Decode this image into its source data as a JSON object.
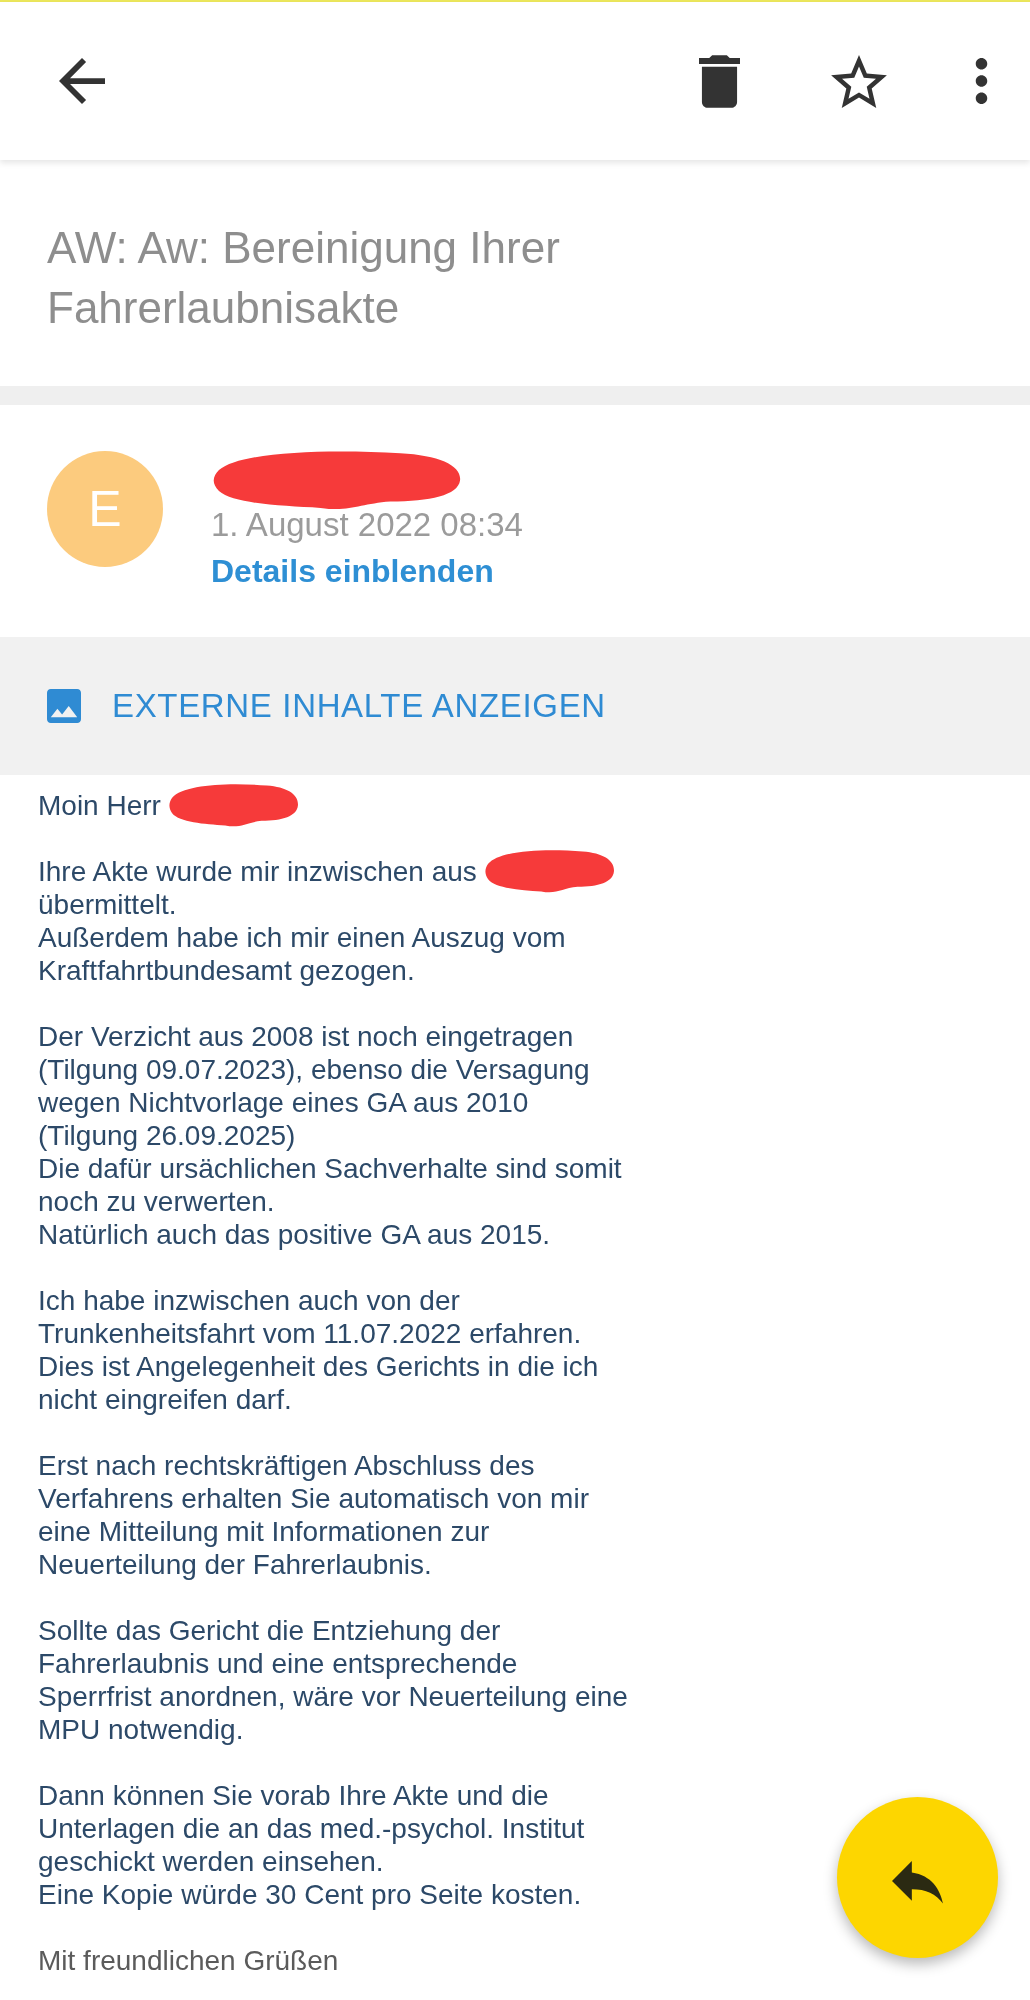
{
  "toolbar": {
    "starred": false
  },
  "subject": "AW: Aw: Bereinigung Ihrer Fahrerlaubnisakte",
  "sender": {
    "initial": "E",
    "name_redacted": true,
    "date": "1. August 2022 08:34",
    "details_link": "Details einblenden"
  },
  "external_content": {
    "label": "EXTERNE INHALTE ANZEIGEN"
  },
  "body": [
    {
      "kind": "text",
      "first_line_redacted": true,
      "lines": [
        "Moin Herr"
      ]
    },
    {
      "kind": "text",
      "first_line_redacted": true,
      "lines": [
        "Ihre Akte wurde mir inzwischen aus",
        "übermittelt.",
        "Außerdem habe ich mir einen Auszug vom",
        "Kraftfahrtbundesamt gezogen."
      ]
    },
    {
      "kind": "text",
      "first_line_redacted": false,
      "lines": [
        "Der Verzicht aus 2008 ist noch eingetragen",
        "(Tilgung 09.07.2023), ebenso die Versagung",
        "wegen Nichtvorlage eines GA aus 2010",
        "(Tilgung 26.09.2025)",
        "Die dafür ursächlichen Sachverhalte sind somit",
        "noch zu verwerten.",
        "Natürlich auch das positive GA aus 2015."
      ]
    },
    {
      "kind": "text",
      "first_line_redacted": false,
      "lines": [
        "Ich habe inzwischen auch von der",
        "Trunkenheitsfahrt vom 11.07.2022 erfahren.",
        "Dies ist Angelegenheit des Gerichts in die ich",
        "nicht eingreifen darf."
      ]
    },
    {
      "kind": "text",
      "first_line_redacted": false,
      "lines": [
        "Erst nach rechtskräftigen Abschluss des",
        "Verfahrens erhalten Sie automatisch von mir",
        "eine Mitteilung mit Informationen zur",
        "Neuerteilung der Fahrerlaubnis."
      ]
    },
    {
      "kind": "text",
      "first_line_redacted": false,
      "lines": [
        "Sollte das Gericht die Entziehung der",
        "Fahrerlaubnis und eine entsprechende",
        "Sperrfrist anordnen, wäre vor Neuerteilung eine",
        "MPU notwendig."
      ]
    },
    {
      "kind": "text",
      "first_line_redacted": false,
      "lines": [
        "Dann können Sie vorab Ihre Akte und die",
        "Unterlagen die an das med.-psychol. Institut",
        "geschickt werden einsehen.",
        "Eine Kopie würde 30 Cent pro Seite kosten."
      ]
    },
    {
      "kind": "signature",
      "first_line_redacted": false,
      "lines": [
        "Mit freundlichen Grüßen"
      ]
    }
  ]
}
